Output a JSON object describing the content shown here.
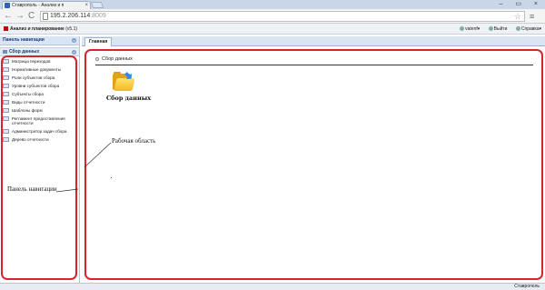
{
  "browser": {
    "tab_title": "Ставрополь - Анализ и п",
    "tab_close": "×",
    "url_host": "195.2.206.114",
    "url_port": ":8009",
    "back": "←",
    "forward": "→",
    "reload": "C",
    "star": "☆",
    "menu": "≡",
    "window_buttons": "– ▭ ×"
  },
  "app_header": {
    "title": "Анализ и планирование",
    "version": "(v5.1)",
    "links": [
      {
        "label": "vatenf▾"
      },
      {
        "label": "Выйти"
      },
      {
        "label": "Справка▾"
      }
    ]
  },
  "nav_panel": {
    "title": "Панель навигации",
    "group": "Сбор данных",
    "items": [
      "Матрица переходов",
      "Нормативные документы",
      "Роли субъектов сбора",
      "Уровни субъектов сбора",
      "Субъекты сбора",
      "Виды отчетности",
      "Шаблоны форм",
      "Регламент предоставления отчетности",
      "Администратор задач сбора",
      "Дерево отчетности"
    ]
  },
  "main": {
    "tab": "Главная",
    "section_title": "Сбор данных",
    "folder_label": "Сбор данных"
  },
  "annotations": {
    "work_area": "Рабочая область",
    "nav_panel": "Панель навигации"
  },
  "status": {
    "text": "Ставрополь"
  },
  "colors": {
    "highlight": "#d9232e",
    "panel_header": "#d9e5f4",
    "folder": "#f4b623"
  }
}
